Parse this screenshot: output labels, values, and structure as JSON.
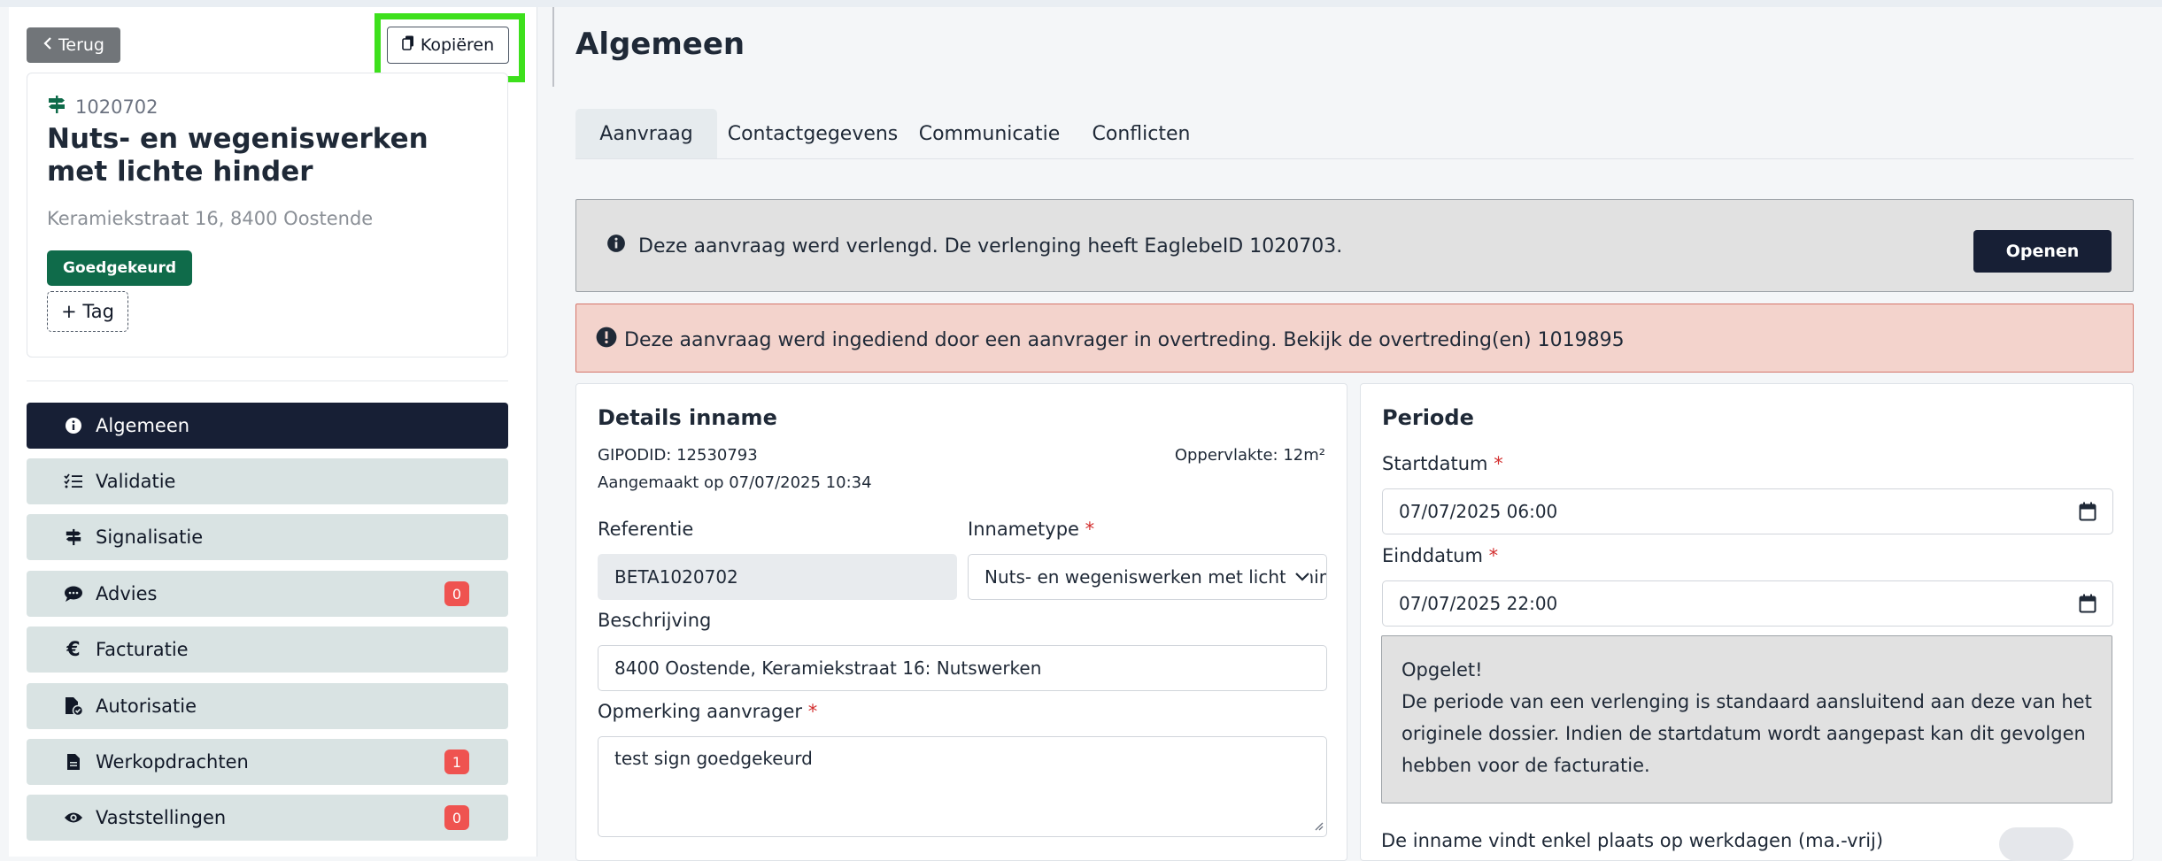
{
  "sidebar": {
    "back_label": "Terug",
    "copy_label": "Kopiëren",
    "case": {
      "id": "1020702",
      "title": "Nuts- en wegeniswerken met lichte hinder",
      "address": "Keramiekstraat 16, 8400 Oostende",
      "status_badge": "Goedgekeurd",
      "add_tag_label": "+ Tag"
    },
    "nav": [
      {
        "label": "Algemeen",
        "icon": "info-icon",
        "active": true
      },
      {
        "label": "Validatie",
        "icon": "checklist-icon"
      },
      {
        "label": "Signalisatie",
        "icon": "signpost-icon"
      },
      {
        "label": "Advies",
        "icon": "comment-icon",
        "count": "0"
      },
      {
        "label": "Facturatie",
        "icon": "euro-icon"
      },
      {
        "label": "Autorisatie",
        "icon": "file-check-icon"
      },
      {
        "label": "Werkopdrachten",
        "icon": "file-icon",
        "count": "1"
      },
      {
        "label": "Vaststellingen",
        "icon": "eye-icon",
        "count": "0"
      }
    ]
  },
  "main": {
    "title": "Algemeen",
    "tabs": [
      "Aanvraag",
      "Contactgegevens",
      "Communicatie",
      "Conflicten"
    ],
    "info_banner": {
      "text": "Deze aanvraag werd verlengd. De verlenging heeft EaglebeID 1020703.",
      "button": "Openen"
    },
    "alert_banner": {
      "text": "Deze aanvraag werd ingediend door een aanvrager in overtreding. Bekijk de overtreding(en) 1019895"
    },
    "details": {
      "title": "Details inname",
      "gipodid": "GIPODID: 12530793",
      "oppervlakte": "Oppervlakte: 12m²",
      "aangemaakt": "Aangemaakt op 07/07/2025 10:34",
      "referentie_label": "Referentie",
      "referentie_value": "BETA1020702",
      "innametype_label": "Innametype",
      "innametype_value": "Nuts- en wegeniswerken met lichte hinder",
      "beschrijving_label": "Beschrijving",
      "beschrijving_value": "8400 Oostende, Keramiekstraat 16: Nutswerken",
      "opmerking_label": "Opmerking aanvrager",
      "opmerking_value": "test sign goedgekeurd"
    },
    "periode": {
      "title": "Periode",
      "start_label": "Startdatum",
      "start_value": "07/07/2025 06:00",
      "end_label": "Einddatum",
      "end_value": "07/07/2025 22:00",
      "warning_title": "Opgelet!",
      "warning_text": "De periode van een verlenging is standaard aansluitend aan deze van het originele dossier. Indien de startdatum wordt aangepast kan dit gevolgen hebben voor de facturatie.",
      "weekdays_label": "De inname vindt enkel plaats op werkdagen (ma.-vrij)"
    },
    "required_marker": "*"
  }
}
